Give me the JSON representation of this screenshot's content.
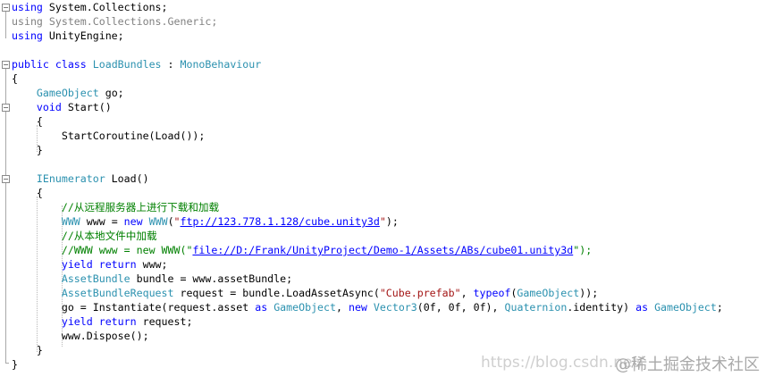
{
  "editor": {
    "lines": [
      {
        "fold": "minus",
        "tokens": [
          {
            "t": "kw",
            "v": "using"
          },
          {
            "t": "pl",
            "v": " System.Collections;"
          }
        ]
      },
      {
        "fold": "",
        "tokens": [
          {
            "t": "gr",
            "v": "using System.Collections.Generic;"
          }
        ]
      },
      {
        "fold": "",
        "tokens": [
          {
            "t": "kw",
            "v": "using"
          },
          {
            "t": "pl",
            "v": " UnityEngine;"
          }
        ]
      },
      {
        "fold": "",
        "tokens": []
      },
      {
        "fold": "minus",
        "tokens": [
          {
            "t": "kw",
            "v": "public class"
          },
          {
            "t": "pl",
            "v": " "
          },
          {
            "t": "ty",
            "v": "LoadBundles"
          },
          {
            "t": "pl",
            "v": " : "
          },
          {
            "t": "ty",
            "v": "MonoBehaviour"
          }
        ]
      },
      {
        "fold": "",
        "tokens": [
          {
            "t": "pl",
            "v": "{"
          }
        ]
      },
      {
        "fold": "",
        "tokens": [
          {
            "t": "pl",
            "v": "    "
          },
          {
            "t": "ty",
            "v": "GameObject"
          },
          {
            "t": "pl",
            "v": " go;"
          }
        ]
      },
      {
        "fold": "minus",
        "tokens": [
          {
            "t": "pl",
            "v": "    "
          },
          {
            "t": "kw",
            "v": "void"
          },
          {
            "t": "pl",
            "v": " Start()"
          }
        ]
      },
      {
        "fold": "",
        "tokens": [
          {
            "t": "pl",
            "v": "    {"
          }
        ]
      },
      {
        "fold": "",
        "tokens": [
          {
            "t": "pl",
            "v": "        StartCoroutine(Load());"
          }
        ]
      },
      {
        "fold": "",
        "tokens": [
          {
            "t": "pl",
            "v": "    }"
          }
        ]
      },
      {
        "fold": "",
        "tokens": []
      },
      {
        "fold": "minus",
        "tokens": [
          {
            "t": "pl",
            "v": "    "
          },
          {
            "t": "ty",
            "v": "IEnumerator"
          },
          {
            "t": "pl",
            "v": " Load()"
          }
        ]
      },
      {
        "fold": "",
        "tokens": [
          {
            "t": "pl",
            "v": "    {"
          }
        ]
      },
      {
        "fold": "",
        "tokens": [
          {
            "t": "pl",
            "v": "        "
          },
          {
            "t": "cm",
            "v": "//从远程服务器上进行下载和加载"
          }
        ]
      },
      {
        "fold": "",
        "tokens": [
          {
            "t": "pl",
            "v": "        "
          },
          {
            "t": "ty",
            "v": "WWW"
          },
          {
            "t": "pl",
            "v": " www = "
          },
          {
            "t": "kw",
            "v": "new"
          },
          {
            "t": "pl",
            "v": " "
          },
          {
            "t": "ty",
            "v": "WWW"
          },
          {
            "t": "pl",
            "v": "("
          },
          {
            "t": "st",
            "v": "\""
          },
          {
            "t": "url",
            "v": "ftp://123.778.1.128/cube.unity3d"
          },
          {
            "t": "st",
            "v": "\""
          },
          {
            "t": "pl",
            "v": ");"
          }
        ]
      },
      {
        "fold": "",
        "tokens": [
          {
            "t": "pl",
            "v": "        "
          },
          {
            "t": "cm",
            "v": "//从本地文件中加载"
          }
        ]
      },
      {
        "fold": "",
        "tokens": [
          {
            "t": "pl",
            "v": "        "
          },
          {
            "t": "cm",
            "v": "//WWW www = new WWW(\""
          },
          {
            "t": "url",
            "v": "file://D:/Frank/UnityProject/Demo-1/Assets/ABs/cube01.unity3d"
          },
          {
            "t": "cm",
            "v": "\");"
          }
        ]
      },
      {
        "fold": "",
        "tokens": [
          {
            "t": "pl",
            "v": "        "
          },
          {
            "t": "kw",
            "v": "yield return"
          },
          {
            "t": "pl",
            "v": " www;"
          }
        ]
      },
      {
        "fold": "",
        "tokens": [
          {
            "t": "pl",
            "v": "        "
          },
          {
            "t": "ty",
            "v": "AssetBundle"
          },
          {
            "t": "pl",
            "v": " bundle = www.assetBundle;"
          }
        ]
      },
      {
        "fold": "",
        "tokens": [
          {
            "t": "pl",
            "v": "        "
          },
          {
            "t": "ty",
            "v": "AssetBundleRequest"
          },
          {
            "t": "pl",
            "v": " request = bundle.LoadAssetAsync("
          },
          {
            "t": "st",
            "v": "\"Cube.prefab\""
          },
          {
            "t": "pl",
            "v": ", "
          },
          {
            "t": "kw",
            "v": "typeof"
          },
          {
            "t": "pl",
            "v": "("
          },
          {
            "t": "ty",
            "v": "GameObject"
          },
          {
            "t": "pl",
            "v": "));"
          }
        ]
      },
      {
        "fold": "",
        "tokens": [
          {
            "t": "pl",
            "v": "        go = Instantiate(request.asset "
          },
          {
            "t": "kw",
            "v": "as"
          },
          {
            "t": "pl",
            "v": " "
          },
          {
            "t": "ty",
            "v": "GameObject"
          },
          {
            "t": "pl",
            "v": ", "
          },
          {
            "t": "kw",
            "v": "new"
          },
          {
            "t": "pl",
            "v": " "
          },
          {
            "t": "ty",
            "v": "Vector3"
          },
          {
            "t": "pl",
            "v": "(0f, 0f, 0f), "
          },
          {
            "t": "ty",
            "v": "Quaternion"
          },
          {
            "t": "pl",
            "v": ".identity) "
          },
          {
            "t": "kw",
            "v": "as"
          },
          {
            "t": "pl",
            "v": " "
          },
          {
            "t": "ty",
            "v": "GameObject"
          },
          {
            "t": "pl",
            "v": ";"
          }
        ]
      },
      {
        "fold": "",
        "tokens": [
          {
            "t": "pl",
            "v": "        "
          },
          {
            "t": "kw",
            "v": "yield return"
          },
          {
            "t": "pl",
            "v": " request;"
          }
        ]
      },
      {
        "fold": "",
        "tokens": [
          {
            "t": "pl",
            "v": "        www.Dispose();"
          }
        ]
      },
      {
        "fold": "",
        "tokens": [
          {
            "t": "pl",
            "v": "    }"
          }
        ]
      },
      {
        "fold": "",
        "tokens": [
          {
            "t": "pl",
            "v": "}"
          }
        ]
      }
    ]
  },
  "watermark": {
    "url_text": "https://blog.csdn.net/",
    "brand_text": "@稀土掘金技术社区"
  },
  "colors": {
    "keyword": "#0000ff",
    "type": "#2b91af",
    "comment": "#008000",
    "string": "#a31515",
    "background": "#ffffff"
  }
}
